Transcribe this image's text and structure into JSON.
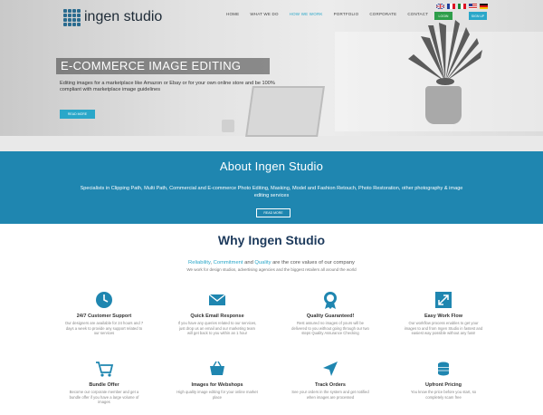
{
  "brand": {
    "name": "ingen studio"
  },
  "nav": {
    "items": [
      "HOME",
      "WHAT WE DO",
      "HOW WE WORK",
      "PORTFOLIO",
      "CORPORATE",
      "CONTACT"
    ]
  },
  "auth": {
    "login": "LOGIN",
    "signup": "SIGN UP"
  },
  "hero": {
    "title": "E-COMMERCE IMAGE EDITING",
    "subtitle": "Editing images for a marketplace like Amazon or Ebay or for your own online store and be 100% compliant with marketplace image guidelines",
    "button": "READ MORE"
  },
  "about": {
    "title": "About Ingen Studio",
    "text": "Specialists in Clipping Path, Multi Path, Commercial and E-commerce Photo Editing, Masking, Model and Fashion Retouch, Photo Restoration, other photography & image editing services",
    "button": "READ MORE"
  },
  "why": {
    "title": "Why Ingen Studio",
    "tagline_1": "Reliability",
    "tagline_sep1": ", ",
    "tagline_2": "Commitment",
    "tagline_sep2": " and ",
    "tagline_3": "Quality",
    "tagline_rest": " are the core values of our company",
    "subline": "We work for design studios, advertising agencies and the biggest retailers all around the world",
    "features": [
      {
        "title": "24/7 Customer Support",
        "desc": "Our designers are available for 24 hours and 7 days a week to provide any support related to our services",
        "icon": "clock-icon"
      },
      {
        "title": "Quick Email Response",
        "desc": "If you have any queries related to our services, just drop us an email and our marketing team will get back to you within an 1 hour",
        "icon": "envelope-icon"
      },
      {
        "title": "Quality Guaranteed!",
        "desc": "Rest assured no images of yours will be delivered to you without going through our two steps Quality Assurance Checking",
        "icon": "medal-icon"
      },
      {
        "title": "Easy Work Flow",
        "desc": "Our workflow process enables to get your images to and from Ingen Studio in fastest and easiest way possible without any fuss!",
        "icon": "expand-icon"
      },
      {
        "title": "Bundle Offer",
        "desc": "Become our corporate member and get a bundle offer if you have a large volume of images",
        "icon": "cart-icon"
      },
      {
        "title": "Images for Webshops",
        "desc": "High quality image editing for your online market place",
        "icon": "basket-icon"
      },
      {
        "title": "Track Orders",
        "desc": "See your orders in the system and get notified when images are processed",
        "icon": "location-arrow-icon"
      },
      {
        "title": "Upfront Pricing",
        "desc": "You know the price before you start, so completely scam free",
        "icon": "coins-icon"
      }
    ]
  },
  "colors": {
    "accent": "#2aa7c9",
    "about_bg": "#1f86b0",
    "login": "#2e9e4a",
    "title": "#1d3a5c"
  }
}
